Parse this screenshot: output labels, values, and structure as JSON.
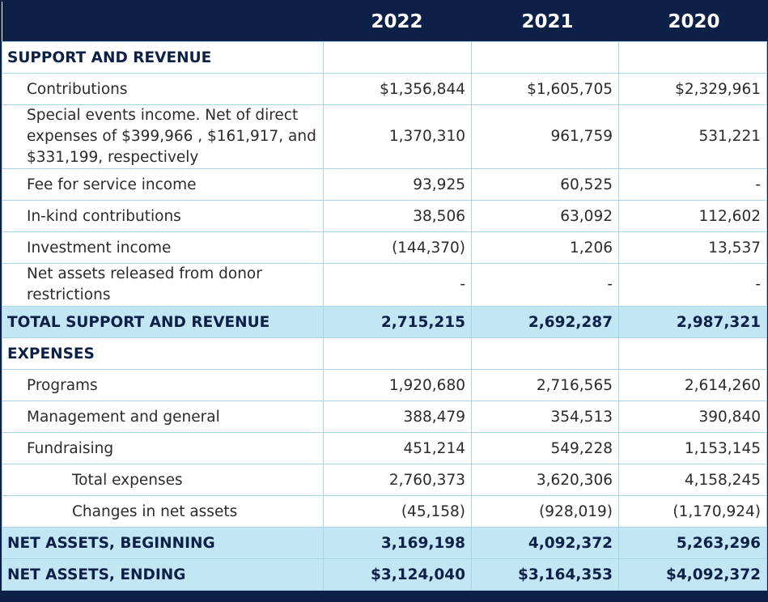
{
  "header": {
    "blank": "",
    "years": [
      "2022",
      "2021",
      "2020"
    ]
  },
  "rows": [
    {
      "label": "SUPPORT AND REVENUE",
      "values": [
        "",
        "",
        ""
      ]
    },
    {
      "label": "Contributions",
      "values": [
        "$1,356,844",
        "$1,605,705",
        "$2,329,961"
      ]
    },
    {
      "label": "Special events income. Net of direct expenses of $399,966 , $161,917, and $331,199, respectively",
      "values": [
        "1,370,310",
        "961,759",
        "531,221"
      ]
    },
    {
      "label": "Fee for service income",
      "values": [
        "93,925",
        "60,525",
        "-"
      ]
    },
    {
      "label": "In-kind contributions",
      "values": [
        "38,506",
        "63,092",
        "112,602"
      ]
    },
    {
      "label": "Investment income",
      "values": [
        "(144,370)",
        "1,206",
        "13,537"
      ]
    },
    {
      "label": "Net assets released from donor restrictions",
      "values": [
        "-",
        "-",
        "-"
      ]
    },
    {
      "label": "TOTAL SUPPORT AND REVENUE",
      "values": [
        "2,715,215",
        "2,692,287",
        "2,987,321"
      ]
    },
    {
      "label": "EXPENSES",
      "values": [
        "",
        "",
        ""
      ]
    },
    {
      "label": "Programs",
      "values": [
        "1,920,680",
        "2,716,565",
        "2,614,260"
      ]
    },
    {
      "label": "Management and general",
      "values": [
        "388,479",
        "354,513",
        "390,840"
      ]
    },
    {
      "label": "Fundraising",
      "values": [
        "451,214",
        "549,228",
        "1,153,145"
      ]
    },
    {
      "label": "Total expenses",
      "values": [
        "2,760,373",
        "3,620,306",
        "4,158,245"
      ]
    },
    {
      "label": "Changes in net assets",
      "values": [
        "(45,158)",
        "(928,019)",
        "(1,170,924)"
      ]
    },
    {
      "label": "NET ASSETS, BEGINNING",
      "values": [
        "3,169,198",
        "4,092,372",
        "5,263,296"
      ]
    },
    {
      "label": "NET ASSETS, ENDING",
      "values": [
        "$3,124,040",
        "$3,164,353",
        "$4,092,372"
      ]
    }
  ],
  "colors": {
    "header_bg": "#0d2148",
    "total_row_bg": "#c3e6f4",
    "grid_line": "#a9d6e7",
    "section_text": "#0d2148"
  }
}
